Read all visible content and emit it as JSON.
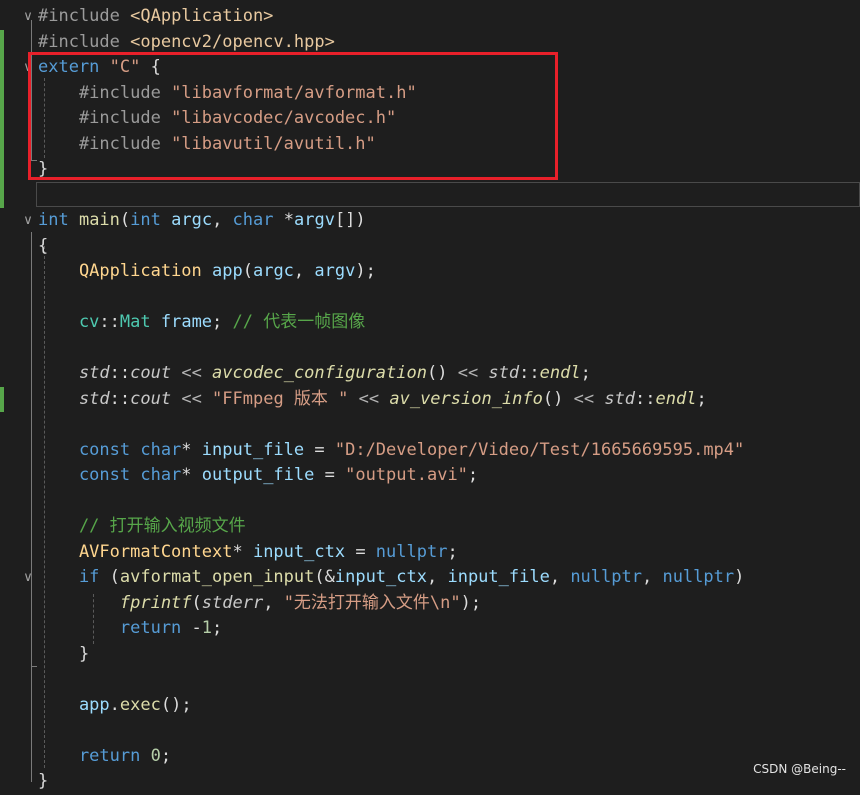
{
  "watermark": "CSDN @Being--",
  "lines": [
    {
      "fold": "v",
      "tokens": [
        {
          "c": "t-dir",
          "t": "#include "
        },
        {
          "c": "t-inc",
          "t": "<QApplication>"
        }
      ]
    },
    {
      "ind": true,
      "tokens": [
        {
          "c": "t-dir",
          "t": "#include "
        },
        {
          "c": "t-inc",
          "t": "<opencv2/opencv.hpp>"
        }
      ]
    },
    {
      "ind": true,
      "fold": "v",
      "tokens": [
        {
          "c": "t-kw",
          "t": "extern "
        },
        {
          "c": "t-str",
          "t": "\"C\" "
        },
        {
          "c": "",
          "t": "{"
        }
      ]
    },
    {
      "ind": true,
      "tokens": [
        {
          "c": "t-dir",
          "t": "    #include "
        },
        {
          "c": "t-str",
          "t": "\"libavformat/avformat.h\""
        }
      ]
    },
    {
      "ind": true,
      "tokens": [
        {
          "c": "t-dir",
          "t": "    #include "
        },
        {
          "c": "t-str",
          "t": "\"libavcodec/avcodec.h\""
        }
      ]
    },
    {
      "ind": true,
      "tokens": [
        {
          "c": "t-dir",
          "t": "    #include "
        },
        {
          "c": "t-str",
          "t": "\"libavutil/avutil.h\""
        }
      ]
    },
    {
      "ind": true,
      "tokens": [
        {
          "c": "",
          "t": "}"
        }
      ]
    },
    {
      "ind": true,
      "tokens": []
    },
    {
      "fold": "v",
      "tokens": [
        {
          "c": "t-kw",
          "t": "int "
        },
        {
          "c": "t-fnc",
          "t": "main"
        },
        {
          "c": "",
          "t": "("
        },
        {
          "c": "t-kw",
          "t": "int "
        },
        {
          "c": "t-par",
          "t": "argc"
        },
        {
          "c": "",
          "t": ", "
        },
        {
          "c": "t-kw",
          "t": "char "
        },
        {
          "c": "",
          "t": "*"
        },
        {
          "c": "t-par",
          "t": "argv"
        },
        {
          "c": "",
          "t": "[])"
        }
      ]
    },
    {
      "tokens": [
        {
          "c": "",
          "t": "{"
        }
      ]
    },
    {
      "tokens": [
        {
          "c": "t-fn",
          "t": "    QApplication "
        },
        {
          "c": "t-par",
          "t": "app"
        },
        {
          "c": "",
          "t": "("
        },
        {
          "c": "t-par",
          "t": "argc"
        },
        {
          "c": "",
          "t": ", "
        },
        {
          "c": "t-par",
          "t": "argv"
        },
        {
          "c": "",
          "t": ");"
        }
      ]
    },
    {
      "tokens": []
    },
    {
      "tokens": [
        {
          "c": "t-ty",
          "t": "    cv"
        },
        {
          "c": "",
          "t": "::"
        },
        {
          "c": "t-ty",
          "t": "Mat "
        },
        {
          "c": "t-par",
          "t": "frame"
        },
        {
          "c": "",
          "t": "; "
        },
        {
          "c": "t-cm",
          "t": "// 代表一帧图像"
        }
      ]
    },
    {
      "tokens": []
    },
    {
      "tokens": [
        {
          "c": "t-it",
          "t": "    std"
        },
        {
          "c": "",
          "t": "::"
        },
        {
          "c": "t-glob",
          "t": "cout "
        },
        {
          "c": "t-op",
          "t": "<< "
        },
        {
          "c": "t-fni",
          "t": "avcodec_configuration"
        },
        {
          "c": "",
          "t": "() "
        },
        {
          "c": "t-op",
          "t": "<< "
        },
        {
          "c": "t-it",
          "t": "std"
        },
        {
          "c": "",
          "t": "::"
        },
        {
          "c": "t-fni",
          "t": "endl"
        },
        {
          "c": "",
          "t": ";"
        }
      ]
    },
    {
      "ind": true,
      "tokens": [
        {
          "c": "t-it",
          "t": "    std"
        },
        {
          "c": "",
          "t": "::"
        },
        {
          "c": "t-glob",
          "t": "cout "
        },
        {
          "c": "t-op",
          "t": "<< "
        },
        {
          "c": "t-str",
          "t": "\"FFmpeg 版本 \" "
        },
        {
          "c": "t-op",
          "t": "<< "
        },
        {
          "c": "t-fni",
          "t": "av_version_info"
        },
        {
          "c": "",
          "t": "() "
        },
        {
          "c": "t-op",
          "t": "<< "
        },
        {
          "c": "t-it",
          "t": "std"
        },
        {
          "c": "",
          "t": "::"
        },
        {
          "c": "t-fni",
          "t": "endl"
        },
        {
          "c": "",
          "t": ";"
        }
      ]
    },
    {
      "tokens": []
    },
    {
      "tokens": [
        {
          "c": "t-kw",
          "t": "    const char"
        },
        {
          "c": "",
          "t": "* "
        },
        {
          "c": "t-par",
          "t": "input_file "
        },
        {
          "c": "",
          "t": "= "
        },
        {
          "c": "t-str",
          "t": "\"D:/Developer/Video/Test/1665669595.mp4\""
        }
      ]
    },
    {
      "tokens": [
        {
          "c": "t-kw",
          "t": "    const char"
        },
        {
          "c": "",
          "t": "* "
        },
        {
          "c": "t-par",
          "t": "output_file "
        },
        {
          "c": "",
          "t": "= "
        },
        {
          "c": "t-str",
          "t": "\"output.avi\""
        },
        {
          "c": "",
          "t": ";"
        }
      ]
    },
    {
      "tokens": []
    },
    {
      "tokens": [
        {
          "c": "t-cm",
          "t": "    // 打开输入视频文件"
        }
      ]
    },
    {
      "tokens": [
        {
          "c": "t-fn",
          "t": "    AVFormatContext"
        },
        {
          "c": "",
          "t": "* "
        },
        {
          "c": "t-par",
          "t": "input_ctx "
        },
        {
          "c": "",
          "t": "= "
        },
        {
          "c": "t-kw",
          "t": "nullptr"
        },
        {
          "c": "",
          "t": ";"
        }
      ]
    },
    {
      "fold": "v",
      "tokens": [
        {
          "c": "t-kw",
          "t": "    if "
        },
        {
          "c": "",
          "t": "("
        },
        {
          "c": "t-fnc",
          "t": "avformat_open_input"
        },
        {
          "c": "",
          "t": "(&"
        },
        {
          "c": "t-par",
          "t": "input_ctx"
        },
        {
          "c": "",
          "t": ", "
        },
        {
          "c": "t-par",
          "t": "input_file"
        },
        {
          "c": "",
          "t": ", "
        },
        {
          "c": "t-kw",
          "t": "nullptr"
        },
        {
          "c": "",
          "t": ", "
        },
        {
          "c": "t-kw",
          "t": "nullptr"
        },
        {
          "c": "",
          "t": ")"
        }
      ]
    },
    {
      "tokens": [
        {
          "c": "t-fni",
          "t": "        fprintf"
        },
        {
          "c": "",
          "t": "("
        },
        {
          "c": "t-glob",
          "t": "stderr"
        },
        {
          "c": "",
          "t": ", "
        },
        {
          "c": "t-str",
          "t": "\"无法打开输入文件\\n\""
        },
        {
          "c": "",
          "t": ");"
        }
      ]
    },
    {
      "tokens": [
        {
          "c": "t-kw",
          "t": "        return "
        },
        {
          "c": "",
          "t": "-"
        },
        {
          "c": "t-num",
          "t": "1"
        },
        {
          "c": "",
          "t": ";"
        }
      ]
    },
    {
      "tokens": [
        {
          "c": "",
          "t": "    }"
        }
      ]
    },
    {
      "tokens": []
    },
    {
      "tokens": [
        {
          "c": "t-par",
          "t": "    app"
        },
        {
          "c": "",
          "t": "."
        },
        {
          "c": "t-fnc",
          "t": "exec"
        },
        {
          "c": "",
          "t": "();"
        }
      ]
    },
    {
      "tokens": []
    },
    {
      "tokens": [
        {
          "c": "t-kw",
          "t": "    return "
        },
        {
          "c": "t-num",
          "t": "0"
        },
        {
          "c": "",
          "t": ";"
        }
      ]
    },
    {
      "tokens": [
        {
          "c": "",
          "t": "}"
        }
      ]
    }
  ]
}
